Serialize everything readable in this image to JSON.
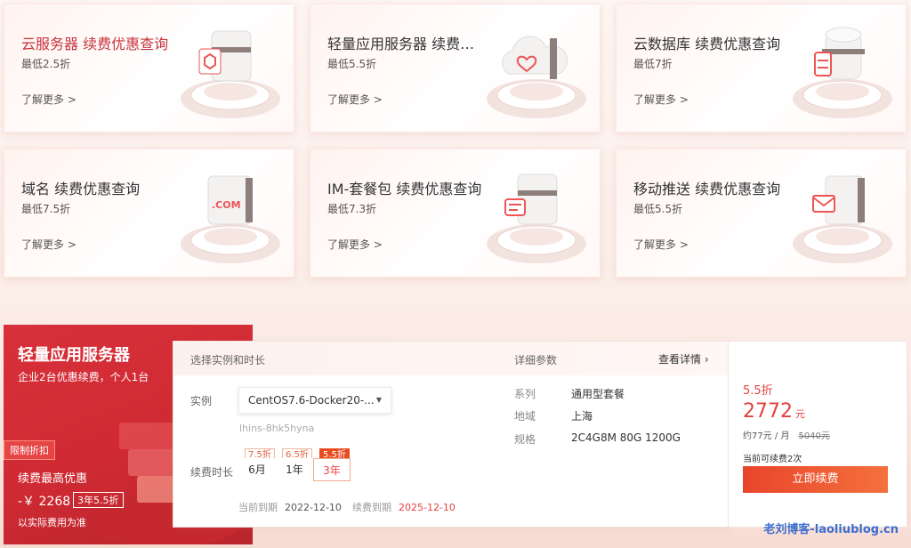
{
  "cards": [
    {
      "title": "云服务器 续费优惠查询",
      "sub": "最低2.5折",
      "more": "了解更多 >"
    },
    {
      "title": "轻量应用服务器 续费优...",
      "sub": "最低5.5折",
      "more": "了解更多 >"
    },
    {
      "title": "云数据库 续费优惠查询",
      "sub": "最低7折",
      "more": "了解更多 >"
    },
    {
      "title": "域名 续费优惠查询",
      "sub": "最低7.5折",
      "more": "了解更多 >"
    },
    {
      "title": "IM-套餐包 续费优惠查询",
      "sub": "最低7.3折",
      "more": "了解更多 >"
    },
    {
      "title": "移动推送 续费优惠查询",
      "sub": "最低5.5折",
      "more": "了解更多 >"
    }
  ],
  "card_icons": [
    "server-icon",
    "cloud-heart-icon",
    "database-icon",
    "domain-com-icon",
    "im-chat-icon",
    "mail-push-icon"
  ],
  "promo": {
    "title": "轻量应用服务器",
    "subtitle": "企业2台优惠续费，个人1台",
    "tag": "限制折扣",
    "label": "续费最高优惠",
    "price": "-￥ 2268",
    "badge": "3年5.5折",
    "note": "以实际费用为准"
  },
  "panel": {
    "header_left": "选择实例和时长",
    "header_mid": "详细参数",
    "header_right": "查看详情",
    "instance_label": "实例",
    "instance_value": "CentOS7.6-Docker20-...",
    "instance_id": "lhins-8hk5hyna",
    "duration_label": "续费时长",
    "durations": [
      {
        "label": "6月",
        "discount": "7.5折"
      },
      {
        "label": "1年",
        "discount": "6.5折"
      },
      {
        "label": "3年",
        "discount": "5.5折"
      }
    ],
    "selected_duration": "3年",
    "current_expiry_label": "当前到期",
    "current_expiry": "2022-12-10",
    "renew_expiry_label": "续费到期",
    "renew_expiry": "2025-12-10",
    "specs": [
      {
        "key": "系列",
        "value": "通用型套餐"
      },
      {
        "key": "地域",
        "value": "上海"
      },
      {
        "key": "规格",
        "value": "2C4G8M 80G 1200G"
      }
    ]
  },
  "price_box": {
    "discount": "5.5折",
    "price": "2772",
    "unit": "元",
    "monthly": "约77元 / 月",
    "original": "5040元",
    "times": "当前可续费2次",
    "button": "立即续费"
  },
  "watermark": "老刘博客-laoliublog.cn",
  "colors": {
    "accent": "#e4413e",
    "promo_bg": "#d8303a",
    "button_start": "#e8452b",
    "button_end": "#f4713d"
  }
}
